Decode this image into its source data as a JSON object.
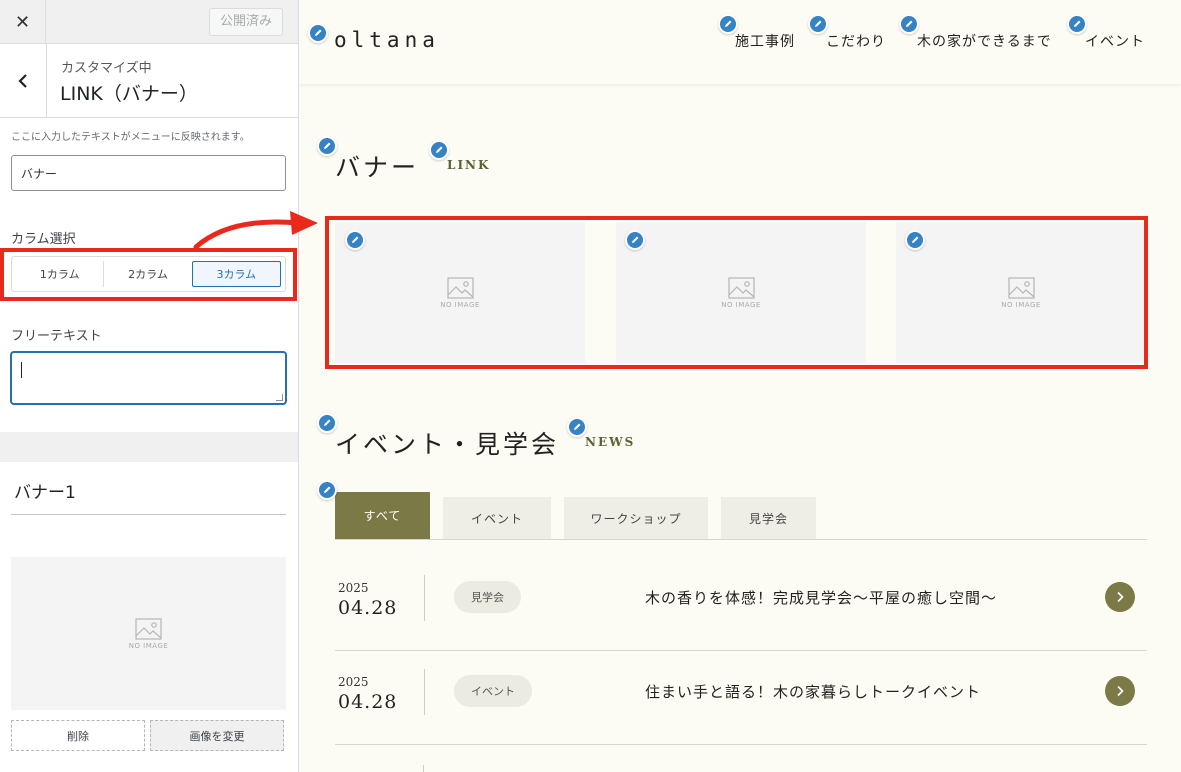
{
  "sidebar": {
    "close_icon": "close-icon",
    "publish_label": "公開済み",
    "section_sub": "カスタマイズ中",
    "section_title": "LINK（バナー）",
    "description": "ここに入力したテキストがメニューに反映されます。",
    "text_value": "バナー",
    "column_label": "カラム選択",
    "column_options": [
      "1カラム",
      "2カラム",
      "3カラム"
    ],
    "column_selected": "3カラム",
    "free_text_label": "フリーテキスト",
    "free_text_value": "",
    "banner1_title": "バナー1",
    "no_image": "NO IMAGE",
    "delete_label": "削除",
    "change_image_label": "画像を変更"
  },
  "preview": {
    "logo": "oltana",
    "nav": [
      "施工事例",
      "こだわり",
      "木の家ができるまで",
      "イベント"
    ],
    "banner_section": {
      "title": "バナー",
      "subtitle": "LINK"
    },
    "banner_tiles": [
      "NO IMAGE",
      "NO IMAGE",
      "NO IMAGE"
    ],
    "news_section": {
      "title": "イベント・見学会",
      "subtitle": "NEWS"
    },
    "tabs": [
      "すべて",
      "イベント",
      "ワークショップ",
      "見学会"
    ],
    "active_tab": "すべて",
    "news": [
      {
        "year": "2025",
        "date": "04.28",
        "category": "見学会",
        "title": "木の香りを体感！完成見学会〜平屋の癒し空間〜"
      },
      {
        "year": "2025",
        "date": "04.28",
        "category": "イベント",
        "title": "住まい手と語る！木の家暮らしトークイベント"
      }
    ]
  },
  "colors": {
    "highlight": "#e8291c",
    "accent": "#7b7a47",
    "edit_pencil": "#3582c4",
    "wp_blue": "#2271b1",
    "preview_bg": "#fdfcf4"
  }
}
